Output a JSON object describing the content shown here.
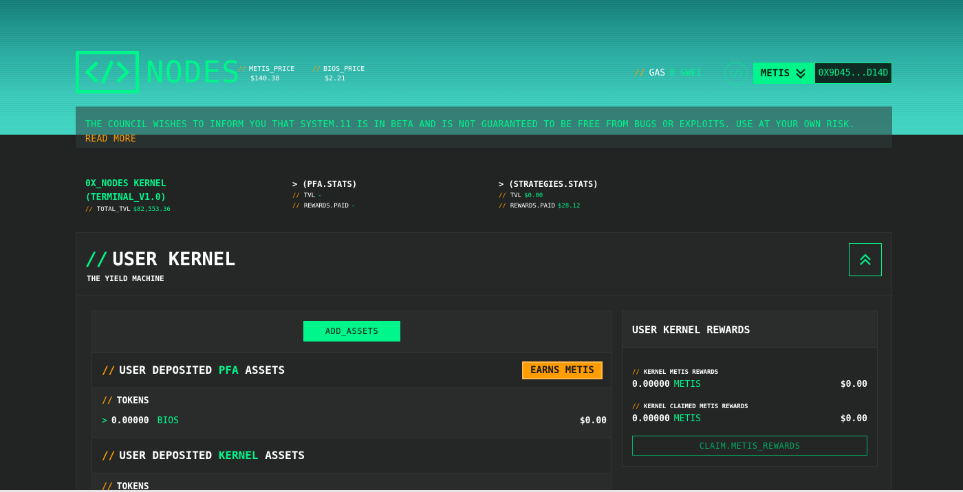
{
  "brand": {
    "logo_icon": "code-brackets-icon",
    "name": "NODES"
  },
  "header": {
    "prices": [
      {
        "label": "METIS_PRICE",
        "value": "$140.38"
      },
      {
        "label": "BIOS_PRICE",
        "value": "$2.21"
      }
    ],
    "gas_label": "GAS",
    "gas_value": "8 GWEI",
    "network_label": "METIS",
    "wallet_address": "0X9D45...D14D"
  },
  "notice": {
    "text": "THE COUNCIL WISHES TO INFORM YOU THAT SYSTEM.11 IS IN BETA AND IS NOT GUARANTEED TO BE FREE FROM BUGS OR EXPLOITS. USE AT YOUR OWN RISK.",
    "link": "READ MORE"
  },
  "stats": {
    "kernel": {
      "title_line1": "0X_NODES KERNEL",
      "title_line2": "(TERMINAL_V1.0)",
      "total_tvl_label": "TOTAL_TVL",
      "total_tvl_value": "$82,553.36"
    },
    "pfa": {
      "title": "> (PFA.STATS)",
      "tvl_label": "TVL",
      "tvl_value": "-",
      "rewards_label": "REWARDS.PAID",
      "rewards_value": "-"
    },
    "strategies": {
      "title": "> (STRATEGIES.STATS)",
      "tvl_label": "TVL",
      "tvl_value": "$0.00",
      "rewards_label": "REWARDS.PAID",
      "rewards_value": "$28.12"
    }
  },
  "panel": {
    "title": "USER KERNEL",
    "subtitle": "THE YIELD MACHINE",
    "add_assets": "ADD_ASSETS",
    "pfa_section": {
      "prefix": "USER DEPOSITED",
      "highlight": "PFA",
      "suffix": "ASSETS",
      "badge": "EARNS METIS",
      "tokens_label": "TOKENS",
      "token": {
        "amount": "0.00000",
        "symbol": "BIOS",
        "usd": "$0.00"
      }
    },
    "kernel_section": {
      "prefix": "USER DEPOSITED",
      "highlight": "KERNEL",
      "suffix": "ASSETS",
      "tokens_label": "TOKENS"
    },
    "rewards": {
      "title": "USER KERNEL REWARDS",
      "items": [
        {
          "label": "KERNEL METIS REWARDS",
          "amount": "0.00000",
          "symbol": "METIS",
          "usd": "$0.00"
        },
        {
          "label": "KERNEL CLAIMED METIS REWARDS",
          "amount": "0.00000",
          "symbol": "METIS",
          "usd": "$0.00"
        }
      ],
      "claim_button": "CLAIM.METIS_REWARDS"
    }
  },
  "colors": {
    "accent_green": "#00f58a",
    "accent_orange": "#ff9d00",
    "background": "#222323"
  }
}
